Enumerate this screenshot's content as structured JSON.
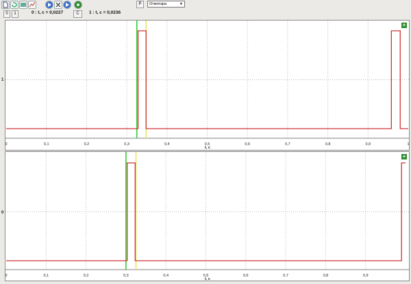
{
  "toolbar": {
    "icons": [
      "file-icon",
      "undo-icon",
      "image-icon",
      "chart-icon",
      "play-icon",
      "close-icon",
      "forward-icon",
      "settings-icon"
    ],
    "small_buttons": [
      "0",
      "1"
    ],
    "cursor0_readout": "0 : t, c = 0,0227",
    "cursor1_readout": "1 : t, c = 0,0236",
    "c_button": "C",
    "p_button": "P",
    "mode_select": "Отмотара"
  },
  "colors": {
    "signal": "#d03030",
    "cursor0": "#33cc33",
    "cursor1": "#e8e85a",
    "grid": "#b8b8b8"
  },
  "chart_data": [
    {
      "type": "line",
      "ylabel": "1",
      "xlabel": "t, c",
      "x_ticks": [
        "0",
        "0,1",
        "0,2",
        "0,3",
        "0,4",
        "0,5",
        "0,6",
        "0,7",
        "0,8",
        "0,9",
        "1"
      ],
      "xlim": [
        0,
        1
      ],
      "ylim": [
        0,
        1
      ],
      "cursors": [
        0.325,
        0.348
      ],
      "points": [
        [
          0,
          0
        ],
        [
          0.328,
          0
        ],
        [
          0.328,
          1
        ],
        [
          0.348,
          1
        ],
        [
          0.348,
          0
        ],
        [
          0.958,
          0
        ],
        [
          0.958,
          1
        ],
        [
          0.98,
          1
        ],
        [
          0.98,
          0
        ],
        [
          1,
          0
        ]
      ]
    },
    {
      "type": "line",
      "ylabel": "0",
      "xlabel": "t, c",
      "x_ticks": [
        "0",
        "0,1",
        "0,2",
        "0,3",
        "0,4",
        "0,5",
        "0,6",
        "0,7",
        "0,8",
        "0,9"
      ],
      "xlim": [
        0,
        1
      ],
      "ylim": [
        0,
        1
      ],
      "cursors": [
        0.3,
        0.325
      ],
      "points": [
        [
          0,
          0
        ],
        [
          0.303,
          0
        ],
        [
          0.303,
          1
        ],
        [
          0.323,
          1
        ],
        [
          0.323,
          0
        ],
        [
          0.99,
          0
        ],
        [
          0.99,
          1
        ],
        [
          1,
          1
        ]
      ]
    }
  ]
}
